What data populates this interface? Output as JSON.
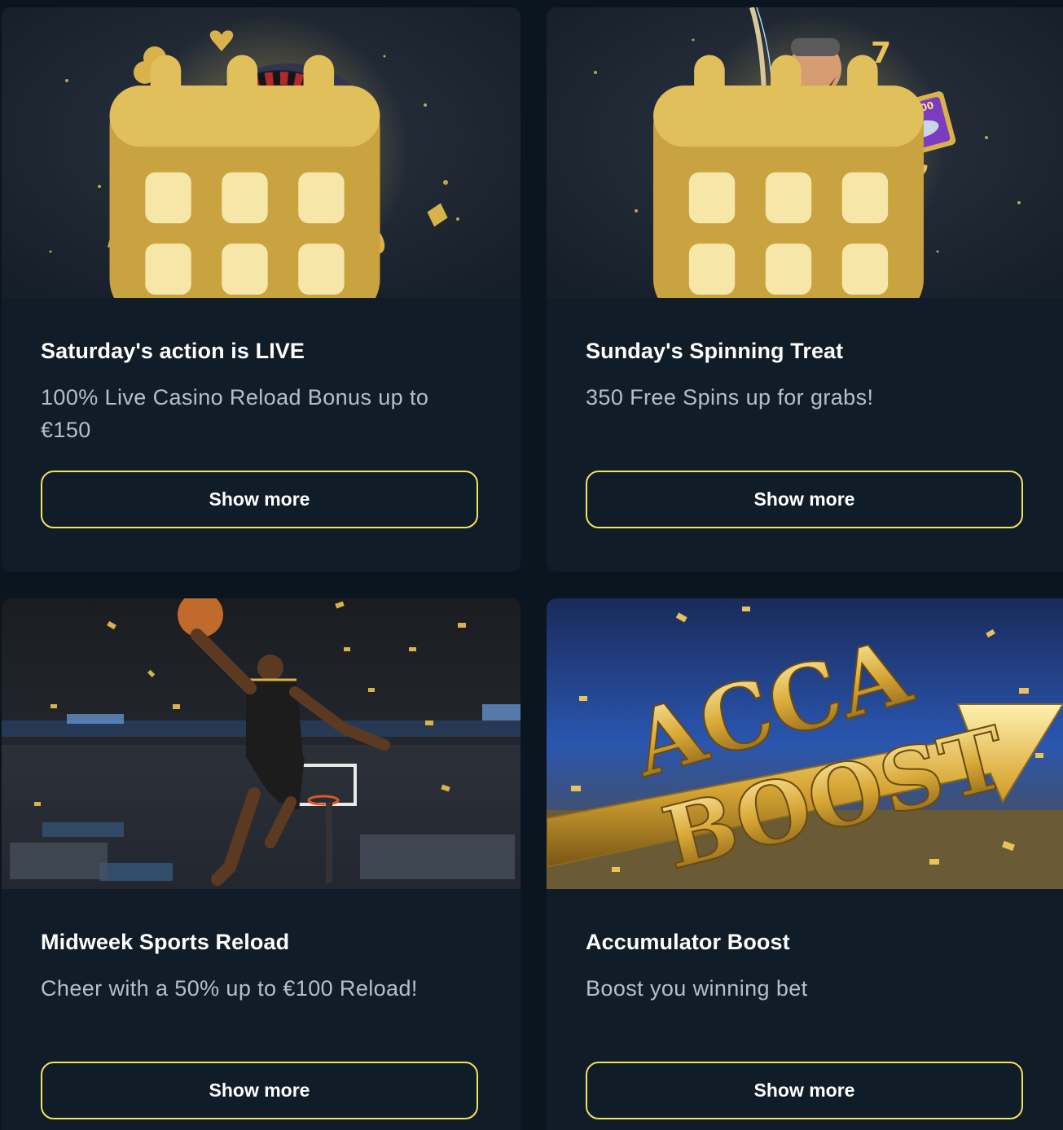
{
  "promotions": [
    {
      "title": "Saturday's action is LIVE",
      "description": "100% Live Casino Reload Bonus up to €150",
      "button_label": "Show more",
      "image": "roulette-wheel-banner",
      "has_calendar_icon": true
    },
    {
      "title": "Sunday's Spinning Treat",
      "description": "350 Free Spins up for grabs!",
      "button_label": "Show more",
      "image": "fisherman-slot-banner",
      "has_calendar_icon": true,
      "banner_badge": "1000"
    },
    {
      "title": "Midweek Sports Reload",
      "description": "Cheer with a 50% up to €100 Reload!",
      "button_label": "Show more",
      "image": "basketball-player-banner"
    },
    {
      "title": "Accumulator Boost",
      "description": "Boost you winning bet",
      "button_label": "Show more",
      "image": "acca-boost-banner",
      "banner_text": [
        "ACCA",
        "BOOST"
      ]
    }
  ],
  "colors": {
    "page_bg": "#0b1520",
    "card_bg": "#111c29",
    "button_border": "#f3e35a",
    "title": "#ffffff",
    "description": "#b6bec9",
    "gold": "#d9b24a"
  }
}
